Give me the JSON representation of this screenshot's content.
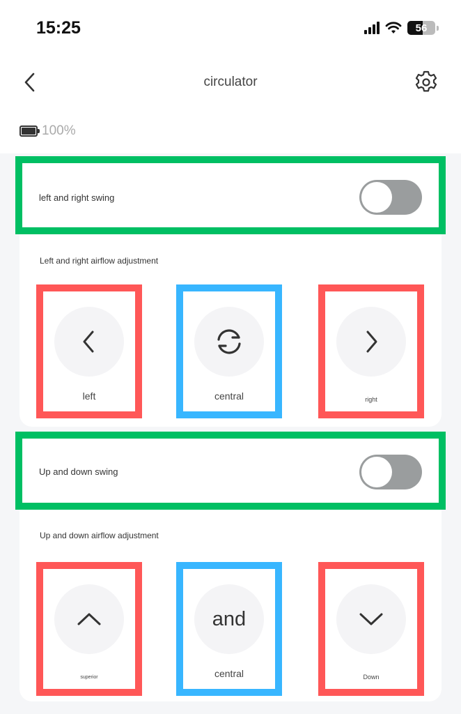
{
  "status_bar": {
    "time": "15:25",
    "battery_level": "56",
    "battery_fraction": 0.56
  },
  "nav": {
    "back_icon": "chevron-left-icon",
    "title": "circulator",
    "settings_icon": "gear-icon"
  },
  "device": {
    "battery_icon": "battery-full-icon",
    "battery_text": "100%",
    "battery_fraction": 1.0
  },
  "horizontal": {
    "swing_label": "left and right swing",
    "swing_on": false,
    "adjust_label": "Left and right airflow adjustment",
    "buttons": [
      {
        "label": "left",
        "icon": "chevron-left-icon"
      },
      {
        "label": "central",
        "icon": "refresh-cycle-icon"
      },
      {
        "label": "right",
        "icon": "chevron-right-icon"
      }
    ]
  },
  "vertical": {
    "swing_label": "Up and down swing",
    "swing_on": false,
    "adjust_label": "Up and down airflow adjustment",
    "buttons": [
      {
        "label": "superior",
        "icon": "chevron-up-icon"
      },
      {
        "label": "central",
        "icon_text": "and"
      },
      {
        "label": "Down",
        "icon": "chevron-down-icon"
      }
    ]
  },
  "colors": {
    "highlight_toggle": "#00bf63",
    "highlight_side": "#ff5757",
    "highlight_center": "#38b6ff",
    "switch_off": "#9a9d9e"
  }
}
